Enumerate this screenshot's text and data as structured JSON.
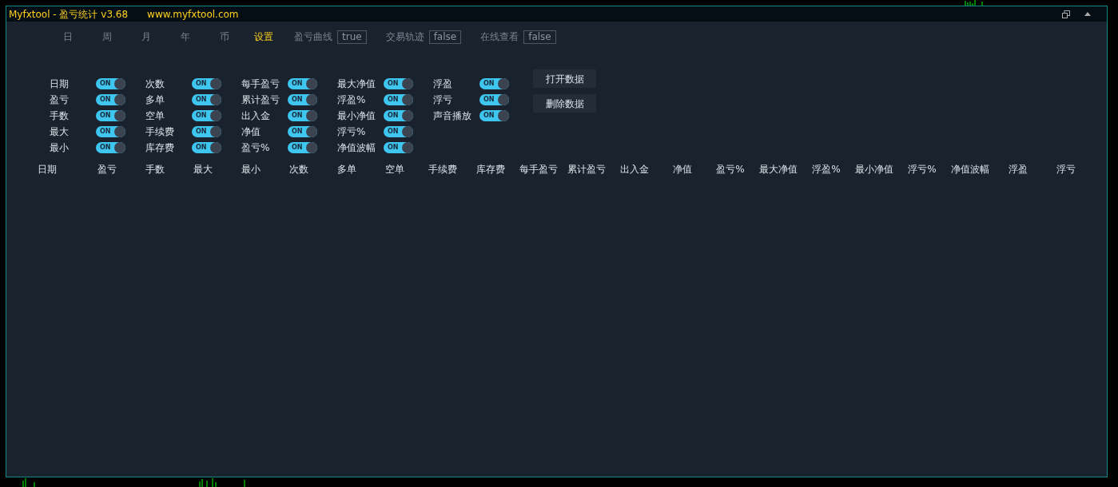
{
  "window": {
    "title": "Myfxtool - 盈亏统计 v3.68",
    "url": "www.myfxtool.com"
  },
  "tabs": [
    {
      "label": "日",
      "selected": false
    },
    {
      "label": "周",
      "selected": false
    },
    {
      "label": "月",
      "selected": false
    },
    {
      "label": "年",
      "selected": false
    },
    {
      "label": "币",
      "selected": false
    },
    {
      "label": "设置",
      "selected": true
    }
  ],
  "options": [
    {
      "label": "盈亏曲线",
      "value": "true"
    },
    {
      "label": "交易轨迹",
      "value": "false"
    },
    {
      "label": "在线查看",
      "value": "false"
    }
  ],
  "toggle_columns": [
    [
      {
        "label": "日期",
        "on": true,
        "text": "ON"
      },
      {
        "label": "盈亏",
        "on": true,
        "text": "ON"
      },
      {
        "label": "手数",
        "on": true,
        "text": "ON"
      },
      {
        "label": "最大",
        "on": true,
        "text": "ON"
      },
      {
        "label": "最小",
        "on": true,
        "text": "ON"
      }
    ],
    [
      {
        "label": "次数",
        "on": true,
        "text": "ON"
      },
      {
        "label": "多单",
        "on": true,
        "text": "ON"
      },
      {
        "label": "空单",
        "on": true,
        "text": "ON"
      },
      {
        "label": "手续费",
        "on": true,
        "text": "ON"
      },
      {
        "label": "库存费",
        "on": true,
        "text": "ON"
      }
    ],
    [
      {
        "label": "每手盈亏",
        "on": true,
        "text": "ON"
      },
      {
        "label": "累计盈亏",
        "on": true,
        "text": "ON"
      },
      {
        "label": "出入金",
        "on": true,
        "text": "ON"
      },
      {
        "label": "净值",
        "on": true,
        "text": "ON"
      },
      {
        "label": "盈亏%",
        "on": true,
        "text": "ON"
      }
    ],
    [
      {
        "label": "最大净值",
        "on": true,
        "text": "ON"
      },
      {
        "label": "浮盈%",
        "on": true,
        "text": "ON"
      },
      {
        "label": "最小净值",
        "on": true,
        "text": "ON"
      },
      {
        "label": "浮亏%",
        "on": true,
        "text": "ON"
      },
      {
        "label": "净值波幅",
        "on": true,
        "text": "ON"
      }
    ],
    [
      {
        "label": "浮盈",
        "on": true,
        "text": "ON"
      },
      {
        "label": "浮亏",
        "on": true,
        "text": "ON"
      },
      {
        "label": "声音播放",
        "on": true,
        "text": "ON"
      }
    ]
  ],
  "buttons": [
    "打开数据",
    "删除数据"
  ],
  "table": {
    "columns": [
      "日期",
      "盈亏",
      "手数",
      "最大",
      "最小",
      "次数",
      "多单",
      "空单",
      "手续费",
      "库存费",
      "每手盈亏",
      "累计盈亏",
      "出入金",
      "净值",
      "盈亏%",
      "最大净值",
      "浮盈%",
      "最小净值",
      "浮亏%",
      "净值波幅",
      "浮盈",
      "浮亏"
    ]
  }
}
